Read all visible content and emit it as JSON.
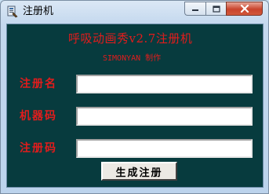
{
  "window": {
    "title": "注册机"
  },
  "icons": {
    "app": "app-icon",
    "minimize": "minimize-icon",
    "maximize": "maximize-icon",
    "close": "close-icon"
  },
  "colors": {
    "client_bg": "#073b3e",
    "label_red": "#e21c1c"
  },
  "header": {
    "headline": "呼吸动画秀v2.7注册机",
    "subline": "SIMONYAN 制作"
  },
  "form": {
    "username_label": "注册名",
    "username_value": "",
    "machine_code_label": "机器码",
    "machine_code_value": "",
    "reg_code_label": "注册码",
    "reg_code_value": "",
    "generate_label": "生成注册"
  }
}
